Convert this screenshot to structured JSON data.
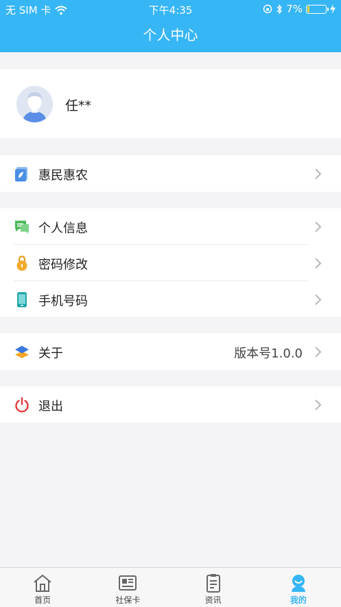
{
  "status_bar": {
    "carrier": "无 SIM 卡",
    "time": "下午4:35",
    "battery": "7%",
    "battery_level": 0.07
  },
  "header": {
    "title": "个人中心"
  },
  "profile": {
    "name": "任**"
  },
  "menu": {
    "huimin": "惠民惠农",
    "personal_info": "个人信息",
    "password": "密码修改",
    "phone": "手机号码",
    "about": "关于",
    "version": "版本号1.0.0",
    "logout": "退出"
  },
  "tabs": [
    {
      "label": "首页",
      "icon": "home-icon"
    },
    {
      "label": "社保卡",
      "icon": "card-icon"
    },
    {
      "label": "资讯",
      "icon": "news-icon"
    },
    {
      "label": "我的",
      "icon": "profile-icon",
      "active": true
    }
  ],
  "colors": {
    "accent": "#37b6f6",
    "logout": "#e5393b"
  }
}
